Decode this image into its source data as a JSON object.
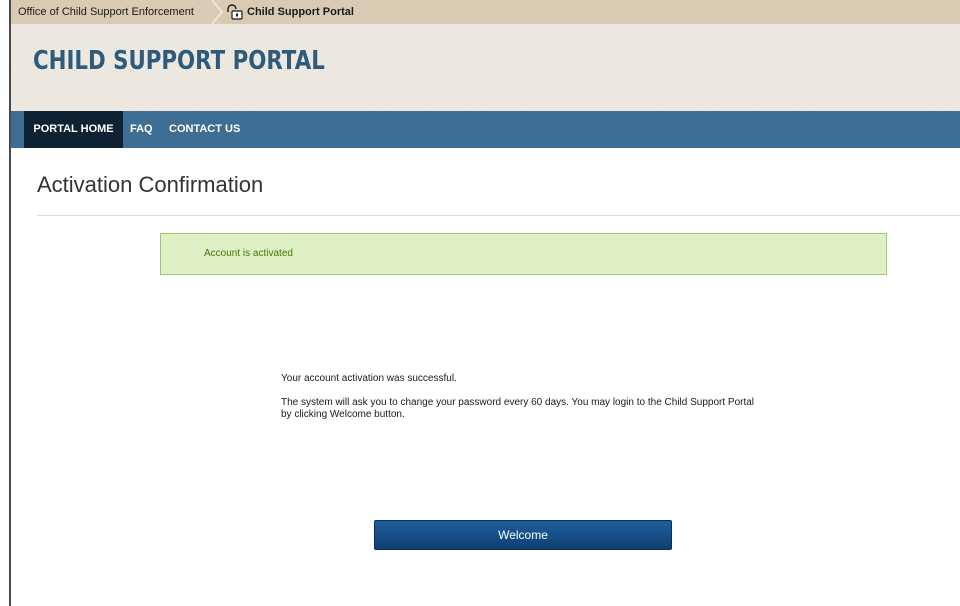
{
  "breadcrumb": {
    "item1": "Office of Child Support Enforcement",
    "item2": "Child Support Portal",
    "item2_icon": "lock-icon"
  },
  "header": {
    "title": "CHILD SUPPORT PORTAL"
  },
  "nav": {
    "items": [
      {
        "label": "PORTAL HOME",
        "active": true
      },
      {
        "label": "FAQ",
        "active": false
      },
      {
        "label": "CONTACT US",
        "active": false
      }
    ]
  },
  "page": {
    "title": "Activation Confirmation"
  },
  "alert": {
    "text": "Account is activated",
    "status": "success"
  },
  "message": {
    "line1": "Your account activation was successful.",
    "line2": "The system will ask you to change your password every 60 days. You may login to the Child Support Portal by clicking Welcome button."
  },
  "buttons": {
    "welcome": "Welcome"
  },
  "colors": {
    "header_title": "#2e5a7c",
    "nav_bg": "#3e6e93",
    "nav_active": "#0e2233",
    "alert_bg": "#dff0c4",
    "alert_border": "#9fc776",
    "alert_text": "#3b7a0a",
    "button": "#1a5390"
  }
}
